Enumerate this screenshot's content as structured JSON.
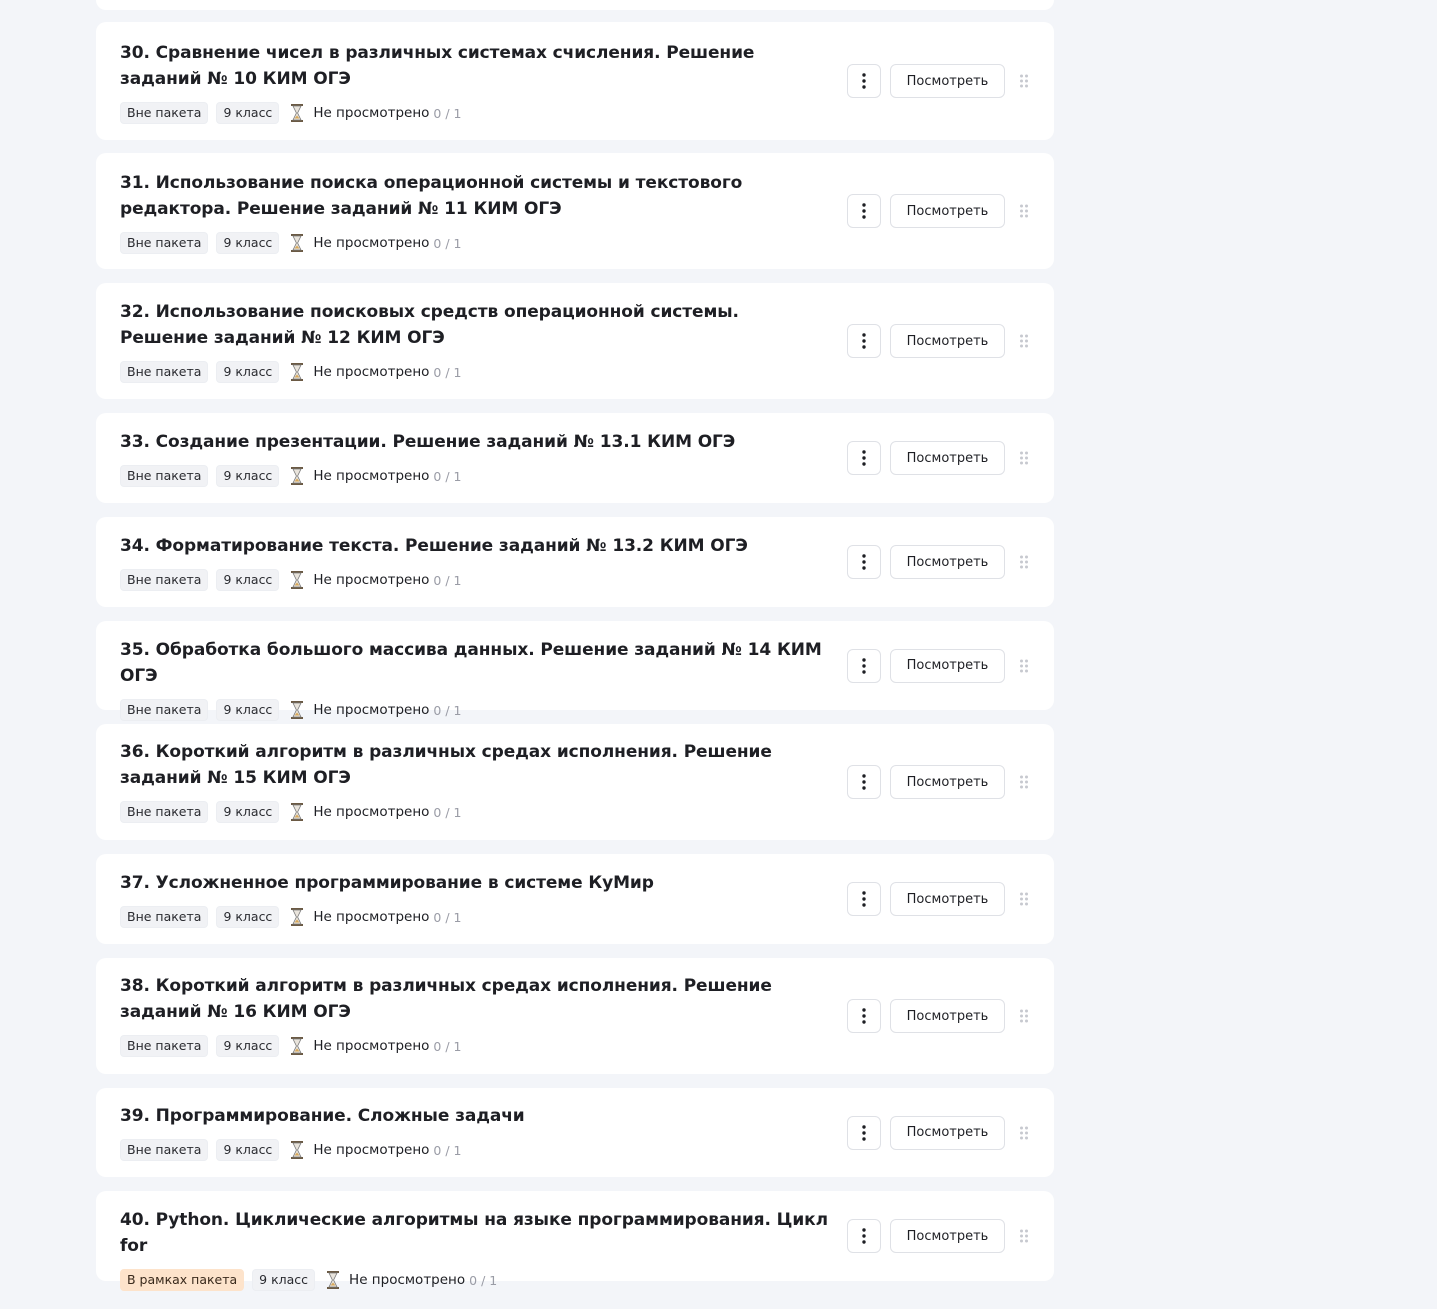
{
  "lessons": [
    {
      "title": "30. Сравнение чисел в различных системах счисления. Решение заданий № 10 КИМ ОГЭ",
      "package": "Вне пакета",
      "grade": "9 класс",
      "status": "Не просмотрено",
      "progress": "0 / 1"
    },
    {
      "title": "31. Использование поиска операционной системы и текстового редактора. Решение заданий № 11 КИМ ОГЭ",
      "package": "Вне пакета",
      "grade": "9 класс",
      "status": "Не просмотрено",
      "progress": "0 / 1"
    },
    {
      "title": "32. Использование поисковых средств операционной системы. Решение заданий № 12 КИМ ОГЭ",
      "package": "Вне пакета",
      "grade": "9 класс",
      "status": "Не просмотрено",
      "progress": "0 / 1"
    },
    {
      "title": "33. Создание презентации. Решение заданий № 13.1 КИМ ОГЭ",
      "package": "Вне пакета",
      "grade": "9 класс",
      "status": "Не просмотрено",
      "progress": "0 / 1"
    },
    {
      "title": "34. Форматирование текста. Решение заданий № 13.2 КИМ ОГЭ",
      "package": "Вне пакета",
      "grade": "9 класс",
      "status": "Не просмотрено",
      "progress": "0 / 1"
    },
    {
      "title": "35. Обработка большого массива данных. Решение заданий № 14 КИМ ОГЭ",
      "package": "Вне пакета",
      "grade": "9 класс",
      "status": "Не просмотрено",
      "progress": "0 / 1"
    },
    {
      "title": "36. Короткий алгоритм в различных средах исполнения. Решение заданий № 15 КИМ ОГЭ",
      "package": "Вне пакета",
      "grade": "9 класс",
      "status": "Не просмотрено",
      "progress": "0 / 1"
    },
    {
      "title": "37. Усложненное программирование в системе КуМир",
      "package": "Вне пакета",
      "grade": "9 класс",
      "status": "Не просмотрено",
      "progress": "0 / 1"
    },
    {
      "title": "38. Короткий алгоритм в различных средах исполнения. Решение заданий № 16 КИМ ОГЭ",
      "package": "Вне пакета",
      "grade": "9 класс",
      "status": "Не просмотрено",
      "progress": "0 / 1"
    },
    {
      "title": "39. Программирование. Сложные задачи",
      "package": "Вне пакета",
      "grade": "9 класс",
      "status": "Не просмотрено",
      "progress": "0 / 1"
    },
    {
      "title": "40. Python. Циклические алгоритмы на языке программирования. Цикл for",
      "package": "В рамках пакета",
      "package_in": true,
      "grade": "9 класс",
      "status": "Не просмотрено",
      "progress": "0 / 1"
    }
  ],
  "view_label": "Посмотреть",
  "icons": {
    "menu": "more-vertical-icon",
    "status": "hourglass-icon",
    "drag": "drag-handle-icon"
  },
  "colors": {
    "background": "#f3f5f9",
    "card": "#ffffff",
    "in_package_tag": "#fde3cb",
    "progress_text": "#9a9ca6"
  }
}
